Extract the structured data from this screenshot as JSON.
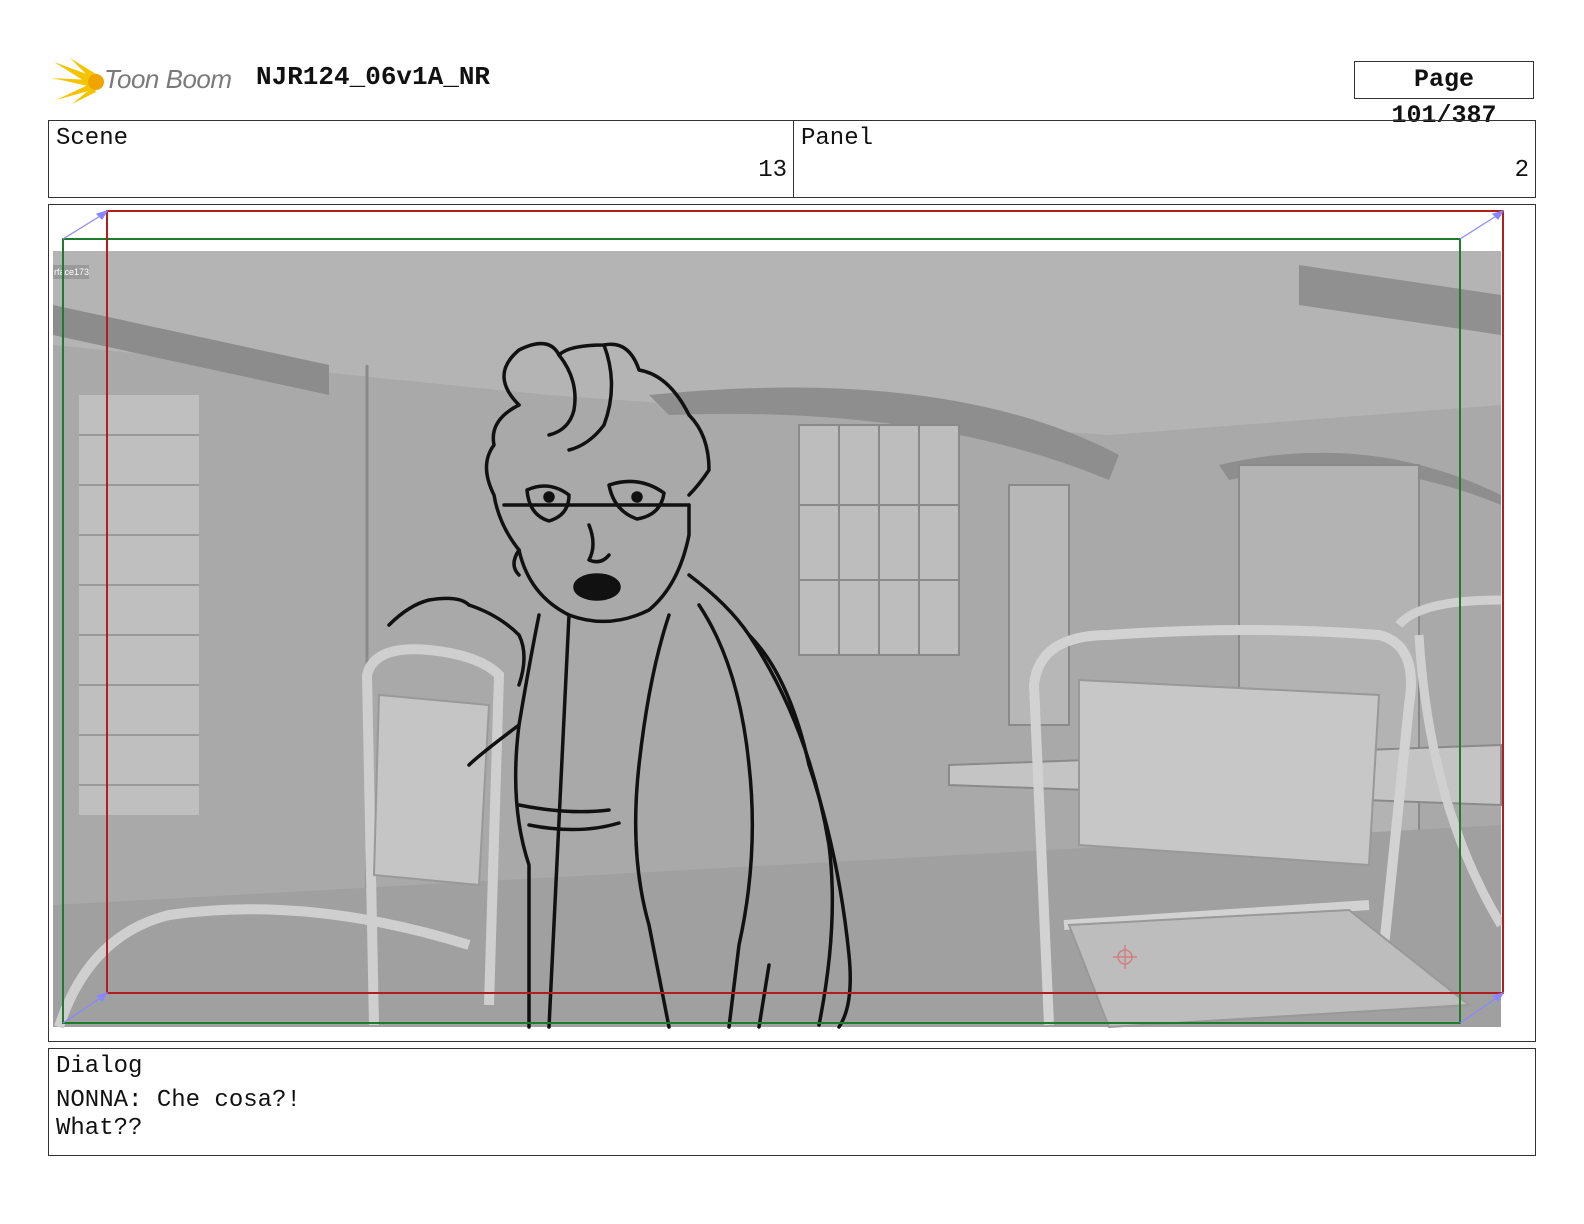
{
  "header": {
    "logo_text": "Toon Boom",
    "title": "NJR124_06v1A_NR",
    "page_label": "Page 101/387"
  },
  "info": {
    "scene_label": "Scene",
    "scene_value": "13",
    "panel_label": "Panel",
    "panel_value": "2"
  },
  "frame": {
    "layer_label": "rface173",
    "colors": {
      "safe_frame": "#b01e1e",
      "title_safe": "#1f7a2a",
      "camera_arrow": "#8a86ff",
      "background": "#a7a7a7"
    }
  },
  "dialog": {
    "label": "Dialog",
    "line1": "NONNA: Che cosa?!",
    "line2": "What??"
  }
}
